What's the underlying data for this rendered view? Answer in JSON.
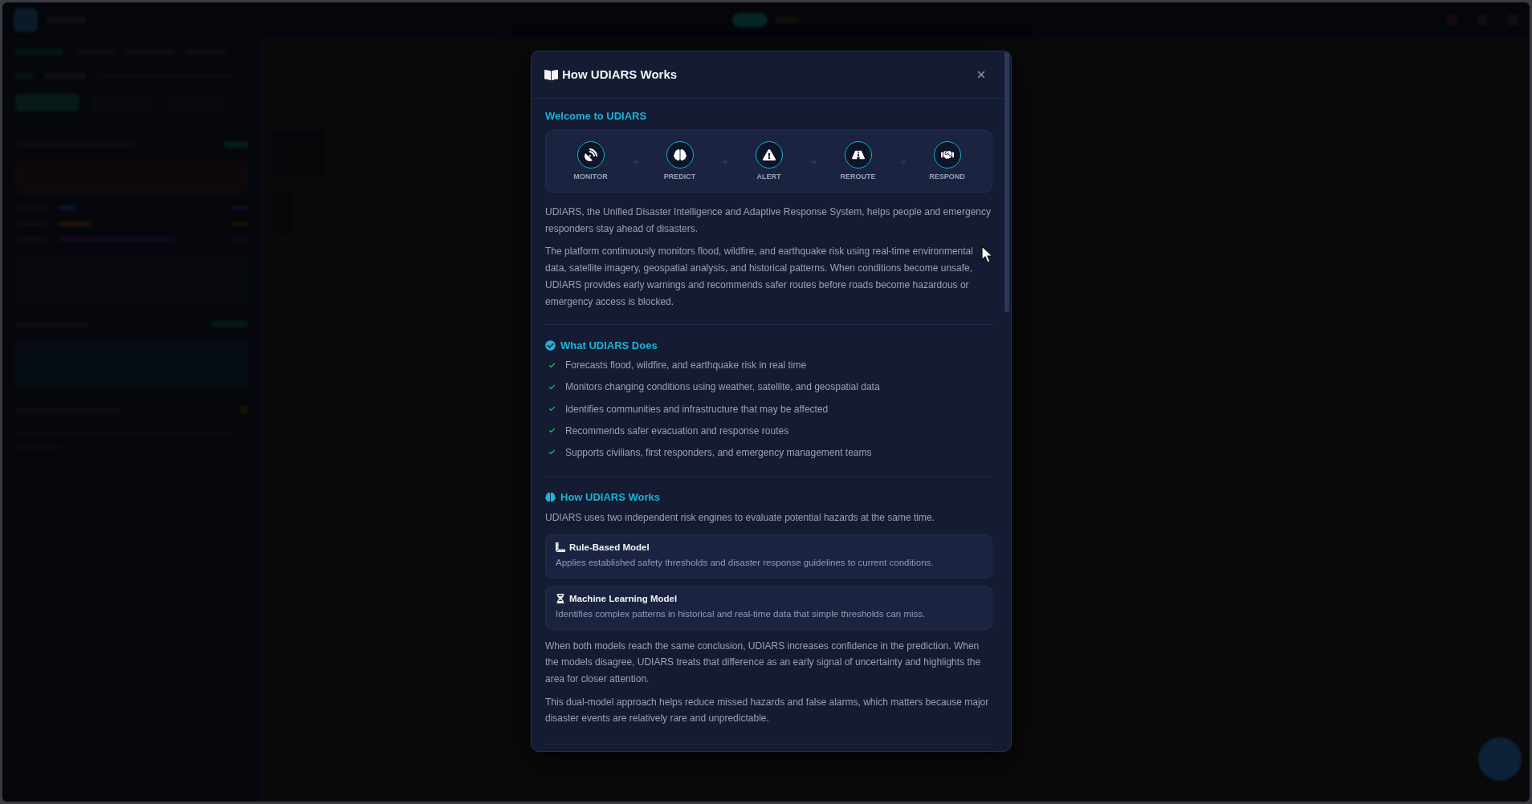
{
  "dialog": {
    "title": "How UDIARS Works"
  },
  "welcome": {
    "heading": "Welcome to UDIARS",
    "steps": [
      {
        "label": "MONITOR"
      },
      {
        "label": "PREDICT"
      },
      {
        "label": "ALERT"
      },
      {
        "label": "REROUTE"
      },
      {
        "label": "RESPOND"
      }
    ],
    "paragraphs": [
      "UDIARS, the Unified Disaster Intelligence and Adaptive Response System, helps people and emergency responders stay ahead of disasters.",
      "The platform continuously monitors flood, wildfire, and earthquake risk using real-time environmental data, satellite imagery, geospatial analysis, and historical patterns. When conditions become unsafe, UDIARS provides early warnings and recommends safer routes before roads become hazardous or emergency access is blocked."
    ]
  },
  "features": {
    "heading": "What UDIARS Does",
    "items": [
      "Forecasts flood, wildfire, and earthquake risk in real time",
      "Monitors changing conditions using weather, satellite, and geospatial data",
      "Identifies communities and infrastructure that may be affected",
      "Recommends safer evacuation and response routes",
      "Supports civilians, first responders, and emergency management teams"
    ]
  },
  "engines": {
    "heading": "How UDIARS Works",
    "intro": "UDIARS uses two independent risk engines to evaluate potential hazards at the same time.",
    "models": [
      {
        "title": "Rule-Based Model",
        "description": "Applies established safety thresholds and disaster response guidelines to current conditions."
      },
      {
        "title": "Machine Learning Model",
        "description": "Identifies complex patterns in historical and real-time data that simple thresholds can miss."
      }
    ],
    "paragraphs": [
      "When both models reach the same conclusion, UDIARS increases confidence in the prediction. When the models disagree, UDIARS treats that difference as an early signal of uncertainty and highlights the area for closer attention.",
      "This dual-model approach helps reduce missed hazards and false alarms, which matters because major disaster events are relatively rare and unpredictable."
    ]
  }
}
